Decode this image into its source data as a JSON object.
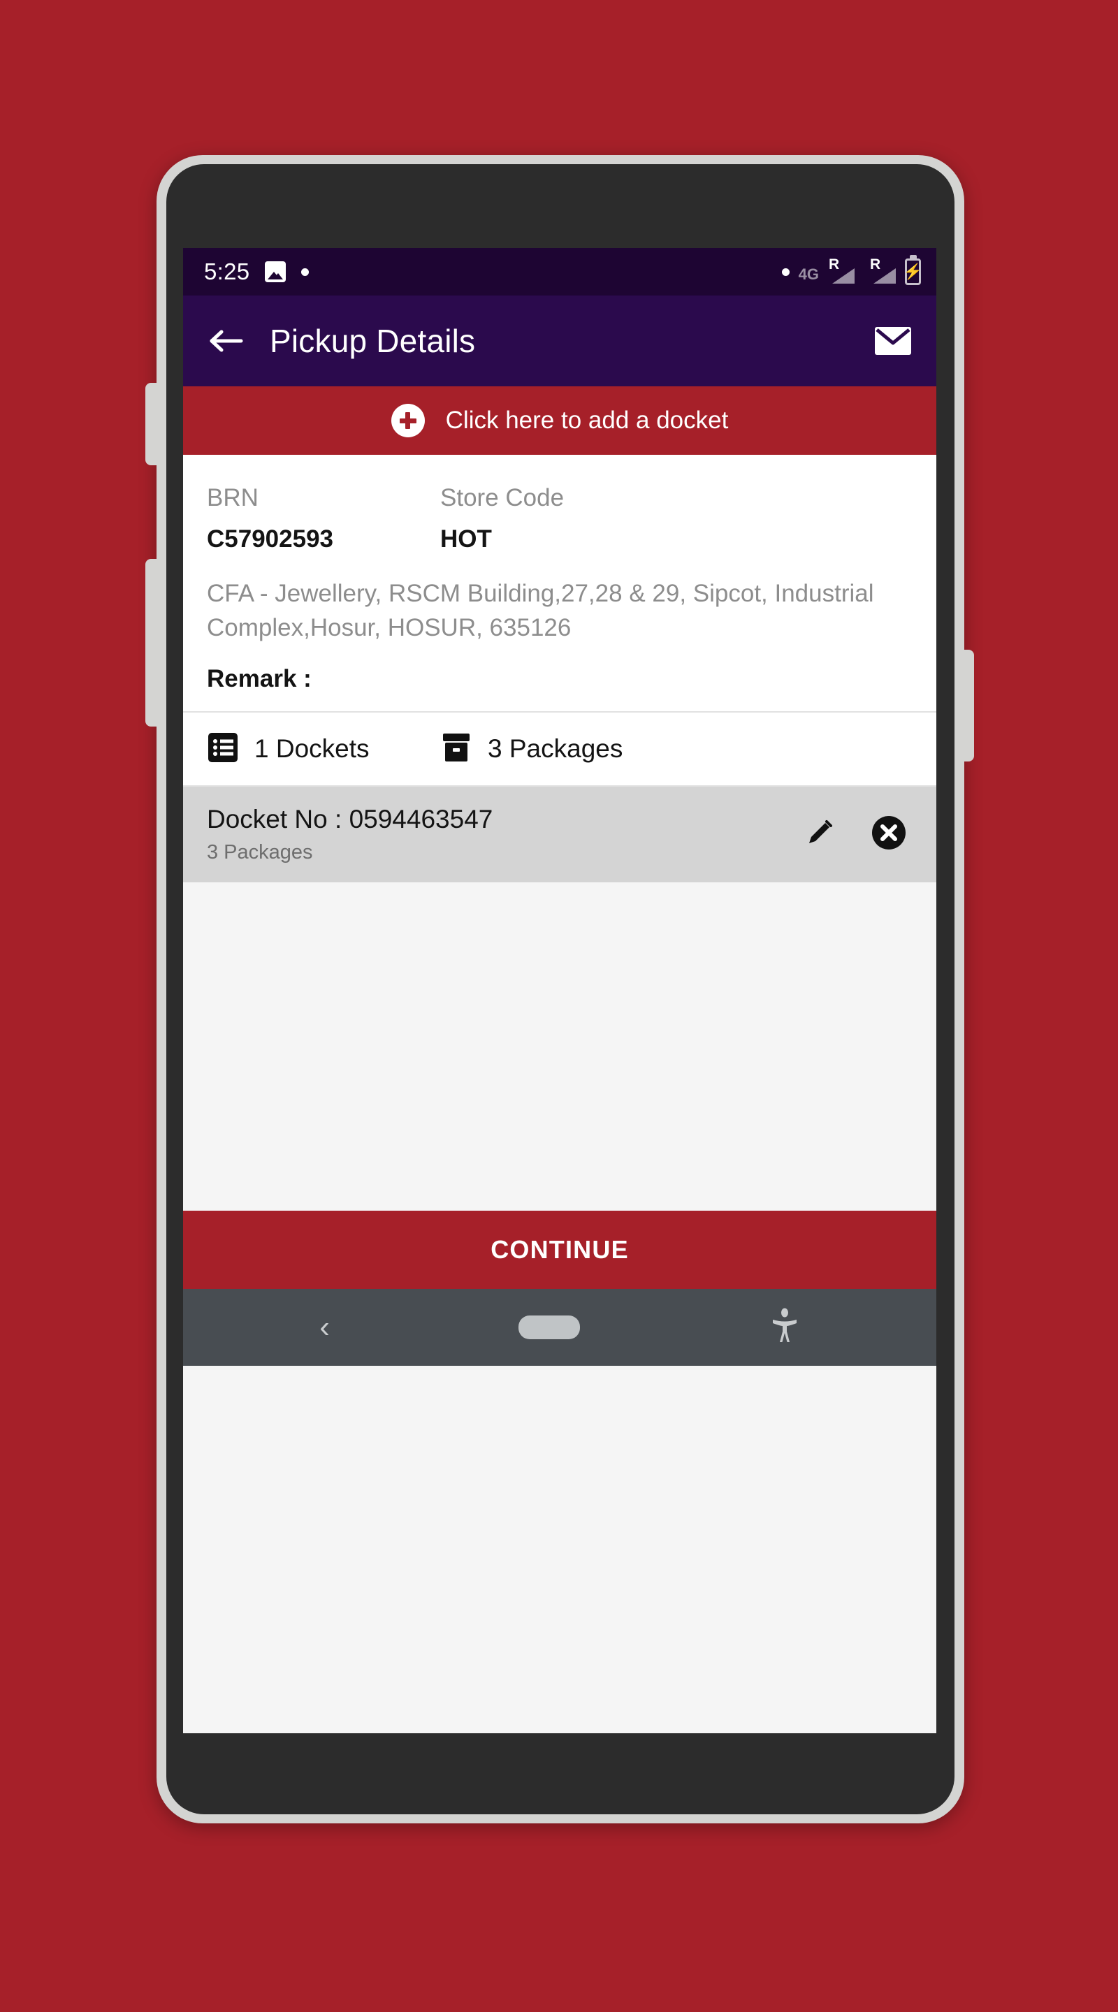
{
  "theme": {
    "background_red": "#a62029",
    "appbar_purple": "#2b0a4d",
    "statusbar_purple": "#1e0533",
    "accent_red": "#a62029",
    "docket_row_grey": "#d4d4d4",
    "navbar_grey": "#484d52"
  },
  "status_bar": {
    "time": "5:25",
    "image_icon": "image-icon",
    "notification_dot": "dot-icon",
    "right_dot": "dot-icon",
    "roaming_label_1": "R",
    "roaming_label_2": "R",
    "network_label": "4G",
    "battery_icon": "battery-charging-icon",
    "battery_bolt": "⚡"
  },
  "app_bar": {
    "back_icon": "back-arrow-icon",
    "title": "Pickup Details",
    "action_icon": "email-icon"
  },
  "add_docket_banner": {
    "plus_icon": "plus-circle-icon",
    "label": "Click here to add a docket"
  },
  "info_card": {
    "brn_label": "BRN",
    "brn_value": "C57902593",
    "store_code_label": "Store Code",
    "store_code_value": "HOT",
    "address": "CFA - Jewellery, RSCM Building,27,28 & 29, Sipcot, Industrial Complex,Hosur, HOSUR, 635126",
    "remark_label": "Remark :",
    "remark_value": ""
  },
  "counts_row": {
    "dockets_icon": "list-document-icon",
    "dockets_text": "1 Dockets",
    "packages_icon": "package-box-icon",
    "packages_text": "3 Packages"
  },
  "docket_list": {
    "rows": [
      {
        "docket_no": "Docket No : 0594463547",
        "packages": "3 Packages",
        "edit_icon": "pencil-edit-icon",
        "delete_icon": "close-circle-icon"
      }
    ]
  },
  "continue_button": {
    "label": "CONTINUE"
  },
  "nav_bar": {
    "back_icon": "nav-back-icon",
    "back_glyph": "‹",
    "home_icon": "nav-home-pill-icon",
    "accessibility_icon": "accessibility-icon"
  }
}
